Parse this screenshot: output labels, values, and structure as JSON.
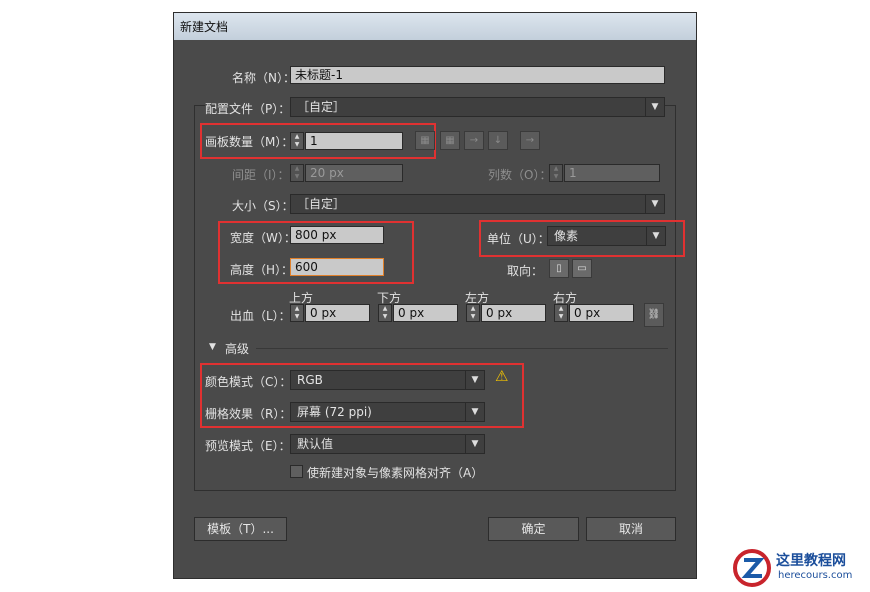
{
  "window": {
    "title": "新建文档"
  },
  "form": {
    "name_label": "名称（N）：",
    "name_value": "未标题-1",
    "profile_label": "配置文件（P）：",
    "profile_value": "［自定］",
    "artboards_label": "画板数量（M）：",
    "artboards_value": "1",
    "spacing_label": "间距（I）：",
    "spacing_value": "20 px",
    "columns_label": "列数（O）：",
    "columns_value": "1",
    "size_label": "大小（S）：",
    "size_value": "［自定］",
    "width_label": "宽度（W）：",
    "width_value": "800 px",
    "height_label": "高度（H）：",
    "height_value": "600",
    "units_label": "单位（U）：",
    "units_value": "像素",
    "orientation_label": "取向：",
    "bleed_label": "出血（L）：",
    "bleed_top_label": "上方",
    "bleed_bottom_label": "下方",
    "bleed_left_label": "左方",
    "bleed_right_label": "右方",
    "bleed_top": "0 px",
    "bleed_bottom": "0 px",
    "bleed_left": "0 px",
    "bleed_right": "0 px"
  },
  "advanced": {
    "header": "高级",
    "color_mode_label": "颜色模式（C）：",
    "color_mode_value": "RGB",
    "raster_label": "栅格效果（R）：",
    "raster_value": "屏幕 (72 ppi)",
    "preview_label": "预览模式（E）：",
    "preview_value": "默认值",
    "align_pixel_label": "使新建对象与像素网格对齐（A）",
    "align_pixel_checked": false
  },
  "buttons": {
    "templates": "模板（T）...",
    "ok": "确定",
    "cancel": "取消"
  },
  "watermark": {
    "title": "这里教程网",
    "url": "herecours.com"
  },
  "colors": {
    "highlight_box": "#e03131",
    "dialog_bg": "#4a4a4a",
    "warning": "#f2c200"
  }
}
